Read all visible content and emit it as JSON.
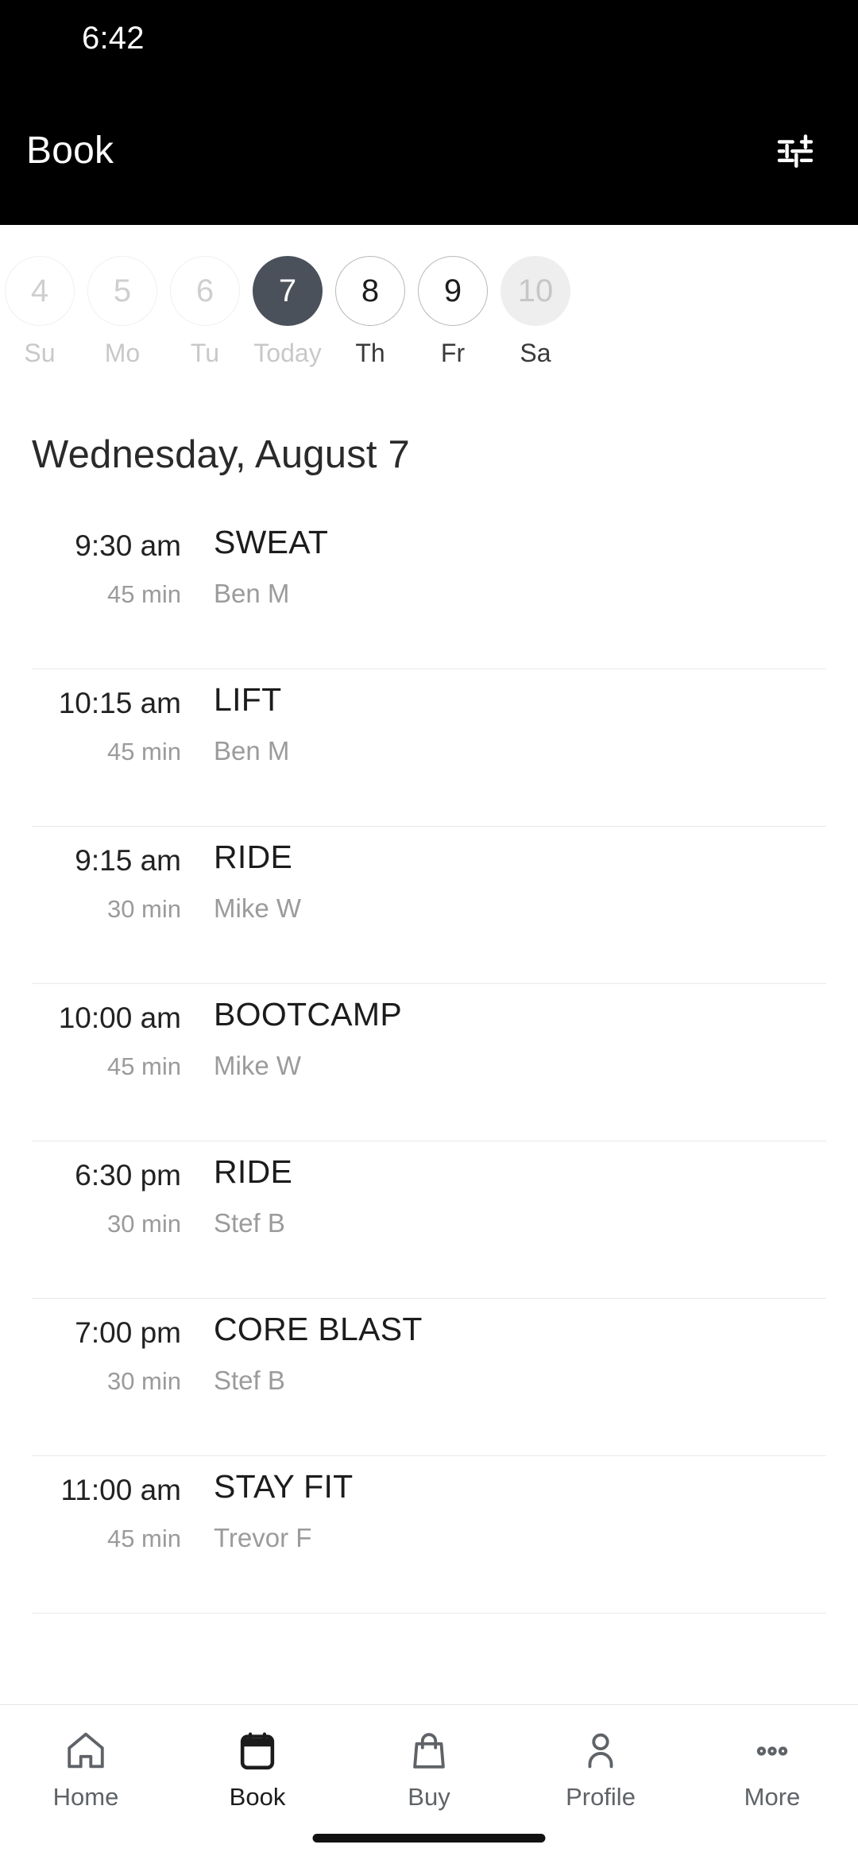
{
  "status_bar": {
    "time": "6:42"
  },
  "app_bar": {
    "title": "Book",
    "filter_icon": "tune-filter-icon"
  },
  "date_strip": {
    "days": [
      {
        "number": "4",
        "label": "Su",
        "state": "past"
      },
      {
        "number": "5",
        "label": "Mo",
        "state": "past"
      },
      {
        "number": "6",
        "label": "Tu",
        "state": "past"
      },
      {
        "number": "7",
        "label": "Today",
        "state": "selected"
      },
      {
        "number": "8",
        "label": "Th",
        "state": "available"
      },
      {
        "number": "9",
        "label": "Fr",
        "state": "available"
      },
      {
        "number": "10",
        "label": "Sa",
        "state": "dim"
      }
    ]
  },
  "schedule": {
    "heading": "Wednesday, August 7",
    "classes": [
      {
        "time": "9:30 am",
        "duration": "45 min",
        "name": "SWEAT",
        "coach": "Ben M"
      },
      {
        "time": "10:15 am",
        "duration": "45 min",
        "name": "LIFT",
        "coach": "Ben M"
      },
      {
        "time": "9:15 am",
        "duration": "30 min",
        "name": "RIDE",
        "coach": "Mike W"
      },
      {
        "time": "10:00 am",
        "duration": "45 min",
        "name": "BOOTCAMP",
        "coach": "Mike W"
      },
      {
        "time": "6:30 pm",
        "duration": "30 min",
        "name": "RIDE",
        "coach": "Stef B"
      },
      {
        "time": "7:00 pm",
        "duration": "30 min",
        "name": "CORE BLAST",
        "coach": "Stef B"
      },
      {
        "time": "11:00 am",
        "duration": "45 min",
        "name": "STAY FIT",
        "coach": "Trevor F"
      }
    ]
  },
  "bottom_nav": {
    "items": [
      {
        "label": "Home",
        "icon": "home-icon",
        "active": false
      },
      {
        "label": "Book",
        "icon": "calendar-icon",
        "active": true
      },
      {
        "label": "Buy",
        "icon": "bag-icon",
        "active": false
      },
      {
        "label": "Profile",
        "icon": "person-icon",
        "active": false
      },
      {
        "label": "More",
        "icon": "dots-icon",
        "active": false
      }
    ]
  },
  "colors": {
    "app_bar_bg": "#000000",
    "selected_day": "#4b515b",
    "muted_text": "#9b9b9b",
    "divider": "#e9e9e9"
  }
}
